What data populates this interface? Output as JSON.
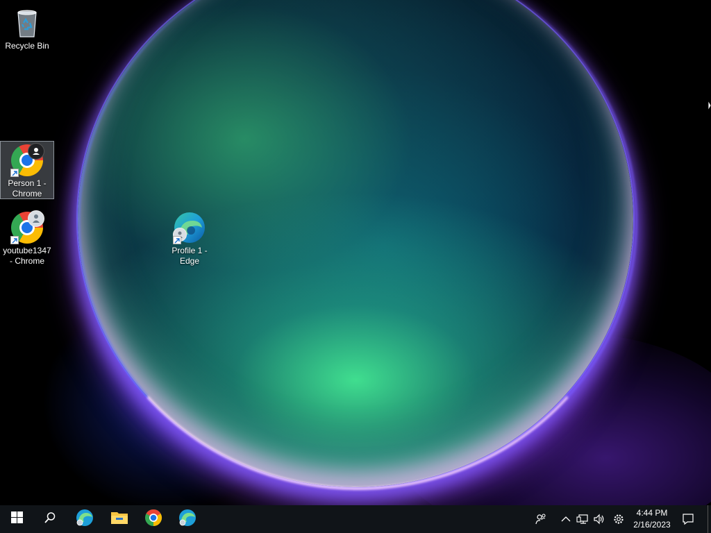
{
  "desktop": {
    "icons": [
      {
        "label": "Recycle Bin",
        "icon": "recycle-bin-icon"
      },
      {
        "label": "Person 1 - Chrome",
        "icon": "chrome-icon",
        "selected": true
      },
      {
        "label": "youtube1347 - Chrome",
        "icon": "chrome-icon"
      },
      {
        "label": "Profile 1 - Edge",
        "icon": "edge-icon"
      }
    ]
  },
  "taskbar": {
    "start_icon": "windows-start-icon",
    "search_icon": "search-icon",
    "pinned": [
      {
        "name": "Microsoft Edge",
        "icon": "edge-icon"
      },
      {
        "name": "File Explorer",
        "icon": "folder-icon"
      },
      {
        "name": "Google Chrome",
        "icon": "chrome-icon"
      },
      {
        "name": "Microsoft Edge",
        "icon": "edge-icon"
      }
    ],
    "tray": {
      "icons": [
        "people-icon",
        "chevron-up-icon",
        "network-icon",
        "volume-icon",
        "gear-icon"
      ],
      "time": "4:44 PM",
      "date": "2/16/2023",
      "notification_icon": "notification-icon"
    }
  },
  "colors": {
    "taskbar_bg": "#101418",
    "desktop_bg": "#000000",
    "selection": "#a0aab4"
  }
}
